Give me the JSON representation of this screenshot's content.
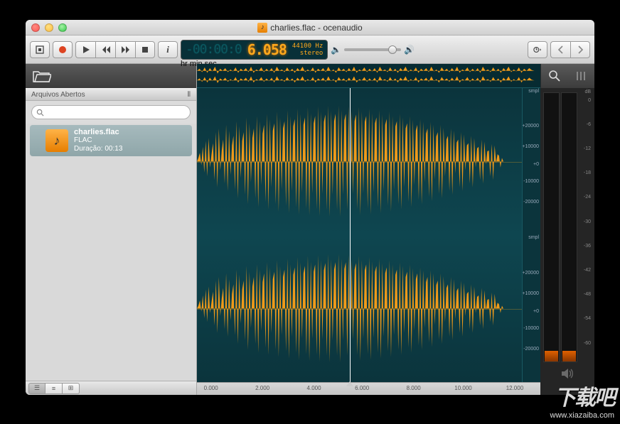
{
  "window": {
    "title": "charlies.flac - ocenaudio"
  },
  "toolbar": {
    "lcd_neg": "-00:00:0",
    "lcd_pos": "6.058",
    "lcd_labels": "hr   min   sec",
    "sample_rate": "44100 Hz",
    "channels": "stereo"
  },
  "sidebar": {
    "section_label": "Arquivos Abertos",
    "search_placeholder": "",
    "file": {
      "name": "charlies.flac",
      "format": "FLAC",
      "duration_label": "Duração: 00:13"
    }
  },
  "amplitude_scale": {
    "unit": "smpl",
    "ticks": [
      "+20000",
      "+10000",
      "+0",
      "-10000",
      "-20000"
    ]
  },
  "time_ruler": [
    "0.000",
    "2.000",
    "4.000",
    "6.000",
    "8.000",
    "10.000",
    "12.000"
  ],
  "meter": {
    "unit": "dB",
    "ticks": [
      "0",
      "-6",
      "-12",
      "-18",
      "-24",
      "-30",
      "-36",
      "-42",
      "-48",
      "-54",
      "-60"
    ],
    "level_left_pct": 4,
    "level_right_pct": 4
  },
  "playhead_time": 6.058,
  "total_time": 13.0,
  "watermark": {
    "text": "下载吧",
    "url": "www.xiazaiba.com"
  }
}
